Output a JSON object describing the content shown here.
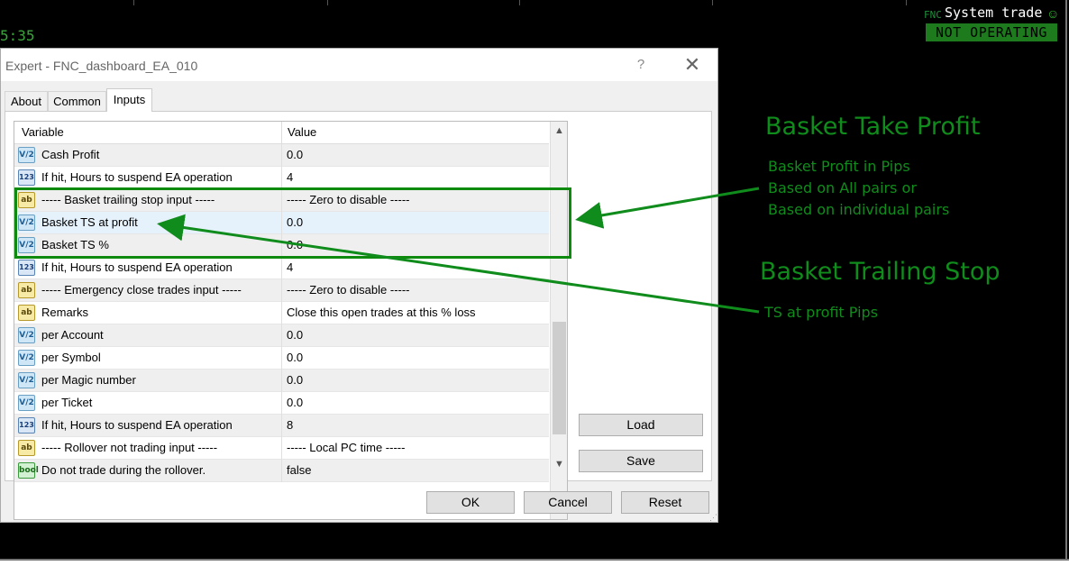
{
  "background": {
    "clock": "5:35",
    "system": {
      "fnc": "FNC",
      "title": "System trade",
      "status": "NOT OPERATING"
    }
  },
  "dialog": {
    "title": "Expert - FNC_dashboard_EA_010",
    "help": "?",
    "close": "✕",
    "tabs": [
      {
        "label": "About",
        "active": false
      },
      {
        "label": "Common",
        "active": false
      },
      {
        "label": "Inputs",
        "active": true
      }
    ],
    "table": {
      "headers": {
        "variable": "Variable",
        "value": "Value"
      },
      "rows": [
        {
          "icon": "V/2",
          "type": "double",
          "variable": "Cash Profit",
          "value": "0.0"
        },
        {
          "icon": "123",
          "type": "int",
          "variable": "If hit, Hours to suspend EA operation",
          "value": "4"
        },
        {
          "icon": "ab",
          "type": "string",
          "variable": "----- Basket trailing stop input -----",
          "value": "----- Zero to disable -----"
        },
        {
          "icon": "V/2",
          "type": "double",
          "variable": "Basket TS at profit",
          "value": "0.0"
        },
        {
          "icon": "V/2",
          "type": "double",
          "variable": "Basket TS %",
          "value": "0.0"
        },
        {
          "icon": "123",
          "type": "int",
          "variable": "If hit, Hours to suspend EA operation",
          "value": "4"
        },
        {
          "icon": "ab",
          "type": "string",
          "variable": "----- Emergency close trades input -----",
          "value": "----- Zero to disable -----"
        },
        {
          "icon": "ab",
          "type": "string",
          "variable": "Remarks",
          "value": "Close this open trades at this % loss"
        },
        {
          "icon": "V/2",
          "type": "double",
          "variable": "per Account",
          "value": "0.0"
        },
        {
          "icon": "V/2",
          "type": "double",
          "variable": "per Symbol",
          "value": "0.0"
        },
        {
          "icon": "V/2",
          "type": "double",
          "variable": "per Magic number",
          "value": "0.0"
        },
        {
          "icon": "V/2",
          "type": "double",
          "variable": "per Ticket",
          "value": "0.0"
        },
        {
          "icon": "123",
          "type": "int",
          "variable": "If hit, Hours to suspend EA operation",
          "value": "8"
        },
        {
          "icon": "ab",
          "type": "string",
          "variable": "----- Rollover not trading input -----",
          "value": "----- Local PC time -----"
        },
        {
          "icon": "bool",
          "type": "bool",
          "variable": "Do not trade during the rollover.",
          "value": "false"
        }
      ],
      "selected_row": 3
    },
    "buttons": {
      "load": "Load",
      "save": "Save",
      "ok": "OK",
      "cancel": "Cancel",
      "reset": "Reset"
    }
  },
  "annotations": {
    "take_profit_title": "Basket Take Profit",
    "take_profit_lines": [
      "Basket Profit in Pips",
      "Based on All pairs or",
      "Based on individual pairs"
    ],
    "trailing_title": "Basket Trailing Stop",
    "trailing_line": "TS at profit Pips",
    "color": "#0f8c1b"
  }
}
